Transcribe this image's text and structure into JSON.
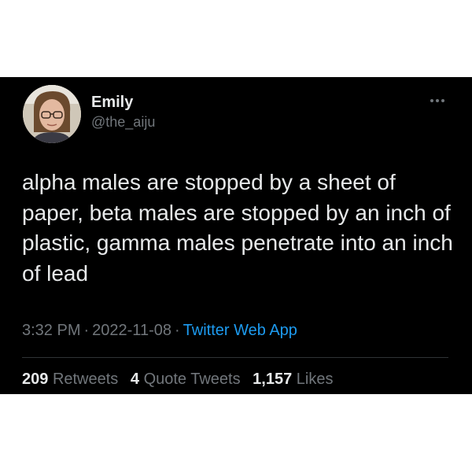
{
  "tweet": {
    "author": {
      "display_name": "Emily",
      "handle": "@the_aiju"
    },
    "text": "alpha males are stopped by a sheet of paper, beta males are stopped by an inch of plastic, gamma males penetrate into an inch of lead",
    "time": "3:32 PM",
    "separator": "·",
    "date": "2022-11-08",
    "source": "Twitter Web App",
    "stats": {
      "retweets_count": "209",
      "retweets_label": "Retweets",
      "quotes_count": "4",
      "quotes_label": "Quote Tweets",
      "likes_count": "1,157",
      "likes_label": "Likes"
    }
  },
  "icons": {
    "more": "more-horizontal-icon"
  },
  "colors": {
    "background": "#000000",
    "text_primary": "#e7e9ea",
    "text_secondary": "#71767b",
    "link": "#1d9bf0",
    "divider": "#2f3336"
  }
}
